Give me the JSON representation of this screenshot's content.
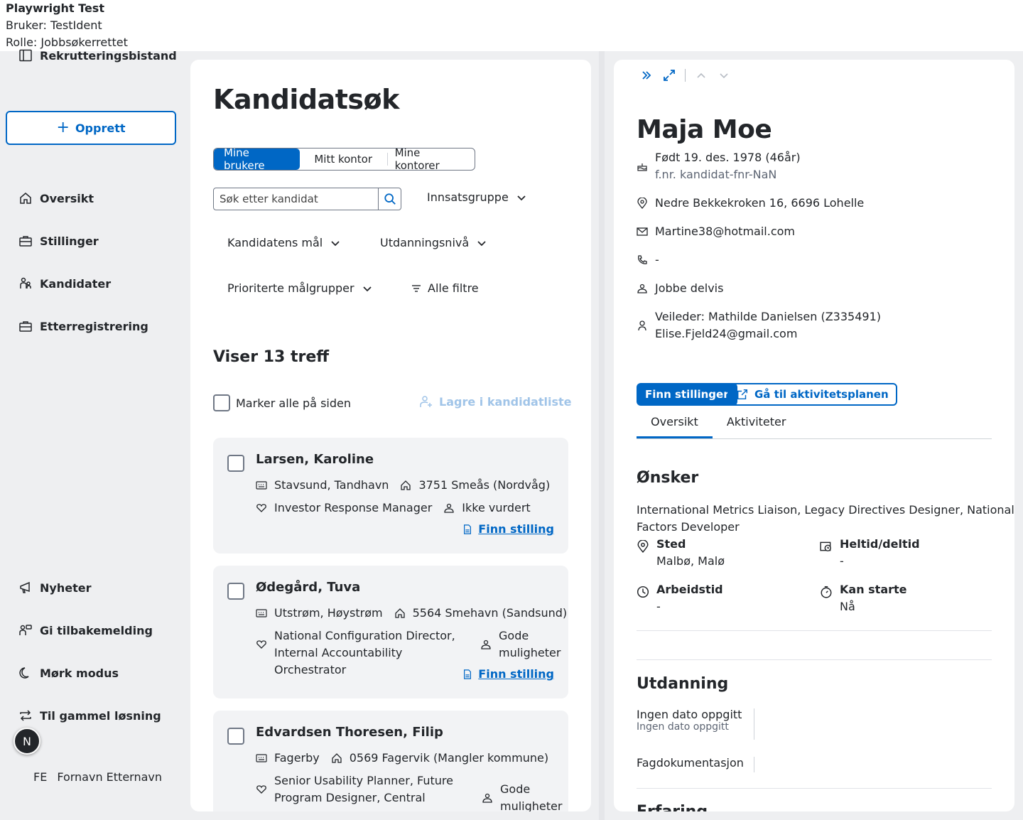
{
  "topbar": {
    "app_name": "Playwright Test",
    "user_line": "Bruker: TestIdent",
    "role_line": "Rolle: Jobbsøkerrettet"
  },
  "sidebar": {
    "title": "Rekrutteringsbistand",
    "create_label": "Opprett",
    "nav": [
      {
        "label": "Oversikt",
        "icon": "home-icon"
      },
      {
        "label": "Stillinger",
        "icon": "briefcase-icon"
      },
      {
        "label": "Kandidater",
        "icon": "people-icon"
      },
      {
        "label": "Etterregistrering",
        "icon": "briefcase-icon"
      }
    ],
    "bottom_nav": [
      {
        "label": "Nyheter",
        "icon": "megaphone-icon"
      },
      {
        "label": "Gi tilbakemelding",
        "icon": "feedback-icon"
      },
      {
        "label": "Mørk modus",
        "icon": "moon-icon"
      },
      {
        "label": "Til gammel løsning",
        "icon": "arrows-icon"
      }
    ],
    "avatar_letter": "N",
    "user_initials": "FE",
    "user_name": "Fornavn Etternavn"
  },
  "search": {
    "title": "Kandidatsøk",
    "toggle": [
      "Mine brukere",
      "Mitt kontor",
      "Mine kontorer"
    ],
    "placeholder": "Søk etter kandidat",
    "filters": {
      "innsatsgruppe": "Innsatsgruppe",
      "maal": "Kandidatens mål",
      "utdanning": "Utdanningsnivå",
      "prioriterte": "Prioriterte målgrupper",
      "alle": "Alle filtre"
    },
    "hits": "Viser 13 treff",
    "mark_all": "Marker alle på siden",
    "save_list": "Lagre i kandidatliste"
  },
  "candidates": [
    {
      "name": "Larsen, Karoline",
      "place": "Stavsund, Tandhavn",
      "address": "3751 Smeås (Nordvåg)",
      "goal": "Investor Response Manager",
      "status": "Ikke vurdert",
      "link": "Finn stilling"
    },
    {
      "name": "Ødegård, Tuva",
      "place": "Utstrøm, Høystrøm",
      "address": "5564 Smehavn (Sandsund)",
      "goal_line1": "National Configuration Director,",
      "goal_line2": "Internal Accountability Orchestrator",
      "status_line1": "Gode",
      "status_line2": "muligheter",
      "link": "Finn stilling"
    },
    {
      "name": "Edvardsen Thoresen, Filip",
      "place": "Fagerby",
      "address": "0569 Fagervik (Mangler kommune)",
      "goal_line1": "Senior Usability Planner, Future",
      "goal_line2": "Program Designer, Central",
      "status_line1": "Gode",
      "status_line2": "muligheter"
    }
  ],
  "detail": {
    "name": "Maja Moe",
    "born": "Født 19. des. 1978 (46år)",
    "fnr": "f.nr. kandidat-fnr-NaN",
    "address": "Nedre Bekkekroken 16, 6696 Lohelle",
    "email": "Martine38@hotmail.com",
    "phone": "-",
    "work": "Jobbe delvis",
    "veileder": "Veileder: Mathilde Danielsen (Z335491)",
    "veileder_email": "Elise.Fjeld24@gmail.com",
    "btn_finn": "Finn stillinger",
    "btn_aktivitet": "Gå til aktivitetsplanen",
    "tabs": [
      "Oversikt",
      "Aktiviteter"
    ],
    "onsker_title": "Ønsker",
    "onsker_line1": "International Metrics Liaison, Legacy Directives Designer, National",
    "onsker_line2": "Factors Developer",
    "sted_label": "Sted",
    "sted_value": "Malbø, Malø",
    "heltid_label": "Heltid/deltid",
    "heltid_value": "-",
    "arbeidstid_label": "Arbeidstid",
    "arbeidstid_value": "-",
    "kanstarte_label": "Kan starte",
    "kanstarte_value": "Nå",
    "utdanning_title": "Utdanning",
    "edu1_title": "Ingen dato oppgitt",
    "edu1_sub": "Ingen dato oppgitt",
    "edu2_title": "Fagdokumentasjon",
    "erfaring_title": "Erfaring"
  },
  "colors": {
    "accent": "#0067c5",
    "background": "#eeeff1"
  }
}
